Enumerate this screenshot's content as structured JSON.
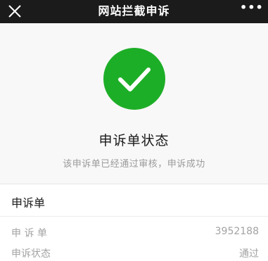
{
  "header": {
    "title": "网站拦截申诉",
    "close_icon": "close-icon",
    "more_icon": "more-icon",
    "more_glyph": "•••"
  },
  "result": {
    "icon": "check-icon",
    "status_title": "申诉单状态",
    "status_desc": "该申诉单已经通过审核，申诉成功",
    "accent_color": "#1dae27"
  },
  "ticket": {
    "header": "申诉单",
    "rows": [
      {
        "label": "申 诉 单",
        "value": "3952188"
      },
      {
        "label": "申诉状态",
        "value": "通过"
      }
    ]
  }
}
